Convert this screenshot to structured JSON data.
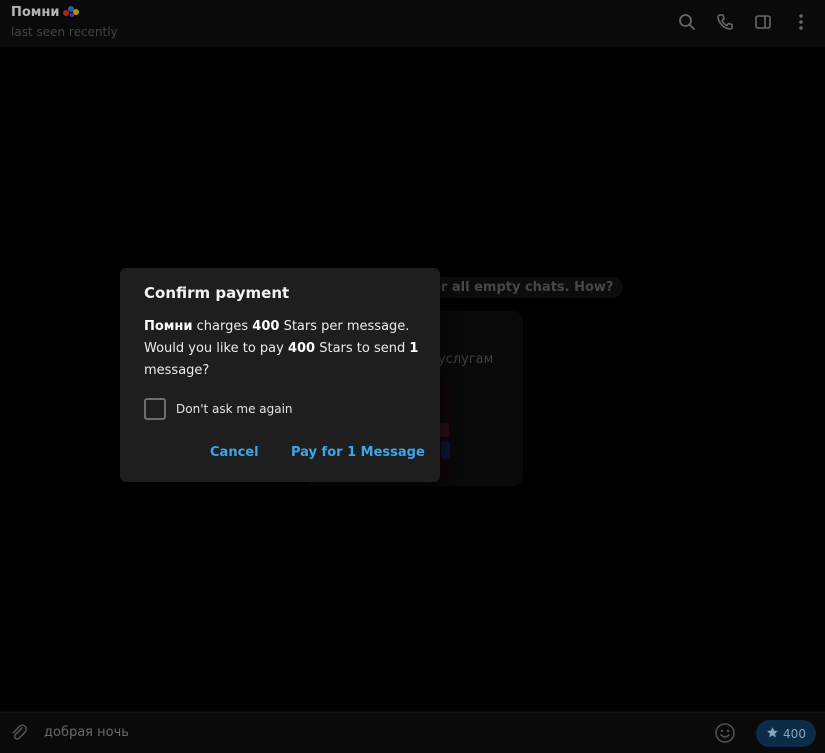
{
  "header": {
    "title": "Помни",
    "subtitle": "last seen recently",
    "icons": [
      "search-icon",
      "phone-icon",
      "sidebar-icon",
      "more-icon"
    ]
  },
  "chat": {
    "hint_text": "or all empty chats. How?",
    "card_text": "услугам"
  },
  "composer": {
    "message_text": "добрая ночь",
    "stars_amount": "400"
  },
  "dialog": {
    "title": "Confirm payment",
    "body": {
      "name": "Помни",
      "t1": " charges ",
      "amount1": "400",
      "t2": " Stars per message. Would you like to pay ",
      "amount2": "400",
      "t3": " Stars to send ",
      "count": "1",
      "t4": " message?"
    },
    "checkbox_label": "Don't ask me again",
    "cancel_label": "Cancel",
    "pay_label": "Pay for 1 Message"
  },
  "colors": {
    "accent": "#3ea6ea",
    "dialog_bg": "#1e1e1e",
    "stars_button_bg": "#0f3a60"
  }
}
